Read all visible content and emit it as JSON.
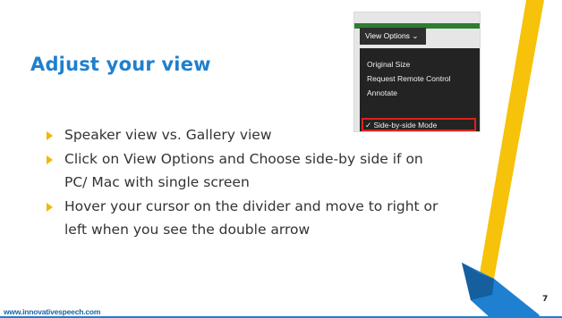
{
  "slide": {
    "title": "Adjust your view",
    "bullets": [
      "Speaker view vs. Gallery view",
      "Click on View Options and Choose side-by side if on PC/ Mac with single screen",
      "Hover your cursor on the divider and move to right or left when you see the double arrow"
    ],
    "footer_url": "www.innovativespeech.com",
    "page_number": "7"
  },
  "screenshot": {
    "button_label": "View Options",
    "button_icon": "chevron-down-icon",
    "menu_items": [
      "Original Size",
      "Request Remote Control",
      "Annotate",
      "Side-by-side Mode"
    ],
    "checkmark": "✓"
  },
  "colors": {
    "title": "#1f7fd0",
    "bullet_marker": "#f2b705",
    "stripe_yellow": "#f6c20a",
    "stripe_blue": "#1f7fd0",
    "selection_border": "#e0201b"
  }
}
